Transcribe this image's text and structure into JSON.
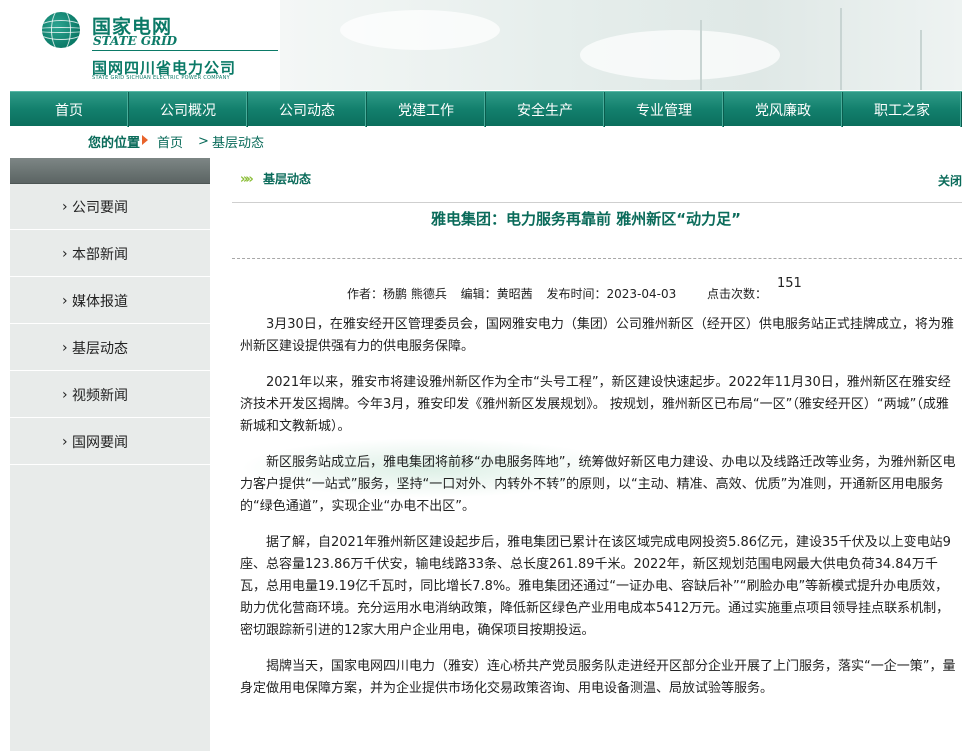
{
  "brand": {
    "cn": "国家电网",
    "en": "STATE GRID",
    "sub": "国网四川省电力公司",
    "sub_en": "STATE GRID SICHUAN ELECTRIC POWER COMPANY",
    "color": "#0b7a67"
  },
  "nav": [
    "首页",
    "公司概况",
    "公司动态",
    "党建工作",
    "安全生产",
    "专业管理",
    "党风廉政",
    "职工之家"
  ],
  "breadcrumb": {
    "label": "您的位置",
    "home": "首页",
    "sep": ">",
    "current": "基层动态"
  },
  "sidebar": [
    "公司要闻",
    "本部新闻",
    "媒体报道",
    "基层动态",
    "视频新闻",
    "国网要闻"
  ],
  "section": {
    "title": "基层动态",
    "more": "关闭"
  },
  "article": {
    "title": "雅电集团：电力服务再靠前 雅州新区“动力足”",
    "author": "作者：杨鹏 熊德兵",
    "editor": "编辑：黄昭茜",
    "date": "发布时间：2023-04-03",
    "hits_label": "点击次数：",
    "hits": "151",
    "paragraphs": [
      "3月30日，在雅安经开区管理委员会，国网雅安电力（集团）公司雅州新区（经开区）供电服务站正式挂牌成立，将为雅州新区建设提供强有力的供电服务保障。",
      "2021年以来，雅安市将建设雅州新区作为全市“头号工程”，新区建设快速起步。2022年11月30日，雅州新区在雅安经济技术开发区揭牌。今年3月，雅安印发《雅州新区发展规划》。 按规划，雅州新区已布局“一区”（雅安经开区）“两城”（成雅新城和文教新城）。",
      "新区服务站成立后，雅电集团将前移“办电服务阵地”，统筹做好新区电力建设、办电以及线路迁改等业务，为雅州新区电力客户提供“一站式”服务，坚持“一口对外、内转外不转”的原则，以“主动、精准、高效、优质”为准则，开通新区用电服务的“绿色通道”，实现企业“办电不出区”。",
      "据了解，自2021年雅州新区建设起步后，雅电集团已累计在该区域完成电网投资5.86亿元，建设35千伏及以上变电站9座、总容量123.86万千伏安，输电线路33条、总长度261.89千米。2022年，新区规划范围电网最大供电负荷34.84万千瓦，总用电量19.19亿千瓦时，同比增长7.8%。雅电集团还通过“一证办电、容缺后补”“刷脸办电”等新模式提升办电质效，助力优化营商环境。充分运用水电消纳政策，降低新区绿色产业用电成本5412万元。通过实施重点项目领导挂点联系机制，密切跟踪新引进的12家大用户企业用电，确保项目按期投运。",
      "揭牌当天，国家电网四川电力（雅安）连心桥共产党员服务队走进经开区部分企业开展了上门服务，落实“一企一策”，量身定做用电保障方案，并为企业提供市场化交易政策咨询、用电设备测温、局放试验等服务。"
    ]
  }
}
